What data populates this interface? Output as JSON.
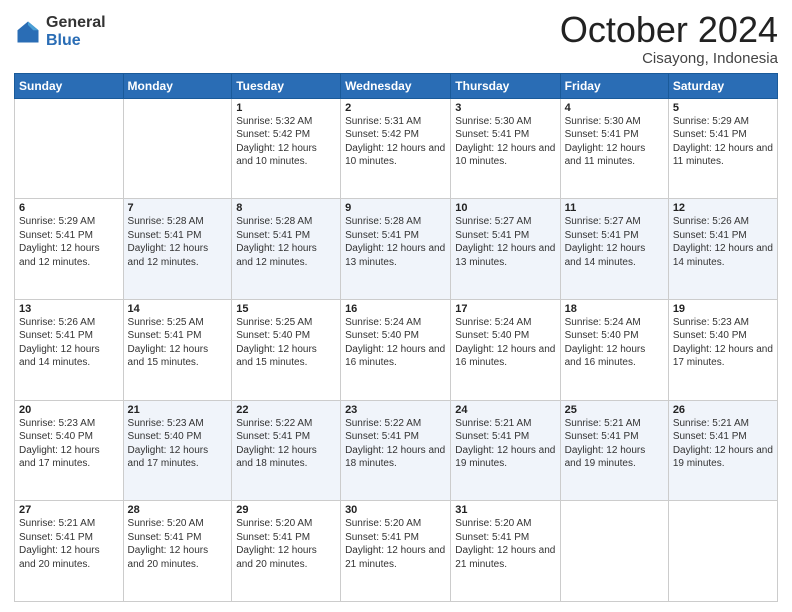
{
  "logo": {
    "general": "General",
    "blue": "Blue"
  },
  "header": {
    "month": "October 2024",
    "location": "Cisayong, Indonesia"
  },
  "weekdays": [
    "Sunday",
    "Monday",
    "Tuesday",
    "Wednesday",
    "Thursday",
    "Friday",
    "Saturday"
  ],
  "weeks": [
    [
      {
        "day": "",
        "sunrise": "",
        "sunset": "",
        "daylight": ""
      },
      {
        "day": "",
        "sunrise": "",
        "sunset": "",
        "daylight": ""
      },
      {
        "day": "1",
        "sunrise": "Sunrise: 5:32 AM",
        "sunset": "Sunset: 5:42 PM",
        "daylight": "Daylight: 12 hours and 10 minutes."
      },
      {
        "day": "2",
        "sunrise": "Sunrise: 5:31 AM",
        "sunset": "Sunset: 5:42 PM",
        "daylight": "Daylight: 12 hours and 10 minutes."
      },
      {
        "day": "3",
        "sunrise": "Sunrise: 5:30 AM",
        "sunset": "Sunset: 5:41 PM",
        "daylight": "Daylight: 12 hours and 10 minutes."
      },
      {
        "day": "4",
        "sunrise": "Sunrise: 5:30 AM",
        "sunset": "Sunset: 5:41 PM",
        "daylight": "Daylight: 12 hours and 11 minutes."
      },
      {
        "day": "5",
        "sunrise": "Sunrise: 5:29 AM",
        "sunset": "Sunset: 5:41 PM",
        "daylight": "Daylight: 12 hours and 11 minutes."
      }
    ],
    [
      {
        "day": "6",
        "sunrise": "Sunrise: 5:29 AM",
        "sunset": "Sunset: 5:41 PM",
        "daylight": "Daylight: 12 hours and 12 minutes."
      },
      {
        "day": "7",
        "sunrise": "Sunrise: 5:28 AM",
        "sunset": "Sunset: 5:41 PM",
        "daylight": "Daylight: 12 hours and 12 minutes."
      },
      {
        "day": "8",
        "sunrise": "Sunrise: 5:28 AM",
        "sunset": "Sunset: 5:41 PM",
        "daylight": "Daylight: 12 hours and 12 minutes."
      },
      {
        "day": "9",
        "sunrise": "Sunrise: 5:28 AM",
        "sunset": "Sunset: 5:41 PM",
        "daylight": "Daylight: 12 hours and 13 minutes."
      },
      {
        "day": "10",
        "sunrise": "Sunrise: 5:27 AM",
        "sunset": "Sunset: 5:41 PM",
        "daylight": "Daylight: 12 hours and 13 minutes."
      },
      {
        "day": "11",
        "sunrise": "Sunrise: 5:27 AM",
        "sunset": "Sunset: 5:41 PM",
        "daylight": "Daylight: 12 hours and 14 minutes."
      },
      {
        "day": "12",
        "sunrise": "Sunrise: 5:26 AM",
        "sunset": "Sunset: 5:41 PM",
        "daylight": "Daylight: 12 hours and 14 minutes."
      }
    ],
    [
      {
        "day": "13",
        "sunrise": "Sunrise: 5:26 AM",
        "sunset": "Sunset: 5:41 PM",
        "daylight": "Daylight: 12 hours and 14 minutes."
      },
      {
        "day": "14",
        "sunrise": "Sunrise: 5:25 AM",
        "sunset": "Sunset: 5:41 PM",
        "daylight": "Daylight: 12 hours and 15 minutes."
      },
      {
        "day": "15",
        "sunrise": "Sunrise: 5:25 AM",
        "sunset": "Sunset: 5:40 PM",
        "daylight": "Daylight: 12 hours and 15 minutes."
      },
      {
        "day": "16",
        "sunrise": "Sunrise: 5:24 AM",
        "sunset": "Sunset: 5:40 PM",
        "daylight": "Daylight: 12 hours and 16 minutes."
      },
      {
        "day": "17",
        "sunrise": "Sunrise: 5:24 AM",
        "sunset": "Sunset: 5:40 PM",
        "daylight": "Daylight: 12 hours and 16 minutes."
      },
      {
        "day": "18",
        "sunrise": "Sunrise: 5:24 AM",
        "sunset": "Sunset: 5:40 PM",
        "daylight": "Daylight: 12 hours and 16 minutes."
      },
      {
        "day": "19",
        "sunrise": "Sunrise: 5:23 AM",
        "sunset": "Sunset: 5:40 PM",
        "daylight": "Daylight: 12 hours and 17 minutes."
      }
    ],
    [
      {
        "day": "20",
        "sunrise": "Sunrise: 5:23 AM",
        "sunset": "Sunset: 5:40 PM",
        "daylight": "Daylight: 12 hours and 17 minutes."
      },
      {
        "day": "21",
        "sunrise": "Sunrise: 5:23 AM",
        "sunset": "Sunset: 5:40 PM",
        "daylight": "Daylight: 12 hours and 17 minutes."
      },
      {
        "day": "22",
        "sunrise": "Sunrise: 5:22 AM",
        "sunset": "Sunset: 5:41 PM",
        "daylight": "Daylight: 12 hours and 18 minutes."
      },
      {
        "day": "23",
        "sunrise": "Sunrise: 5:22 AM",
        "sunset": "Sunset: 5:41 PM",
        "daylight": "Daylight: 12 hours and 18 minutes."
      },
      {
        "day": "24",
        "sunrise": "Sunrise: 5:21 AM",
        "sunset": "Sunset: 5:41 PM",
        "daylight": "Daylight: 12 hours and 19 minutes."
      },
      {
        "day": "25",
        "sunrise": "Sunrise: 5:21 AM",
        "sunset": "Sunset: 5:41 PM",
        "daylight": "Daylight: 12 hours and 19 minutes."
      },
      {
        "day": "26",
        "sunrise": "Sunrise: 5:21 AM",
        "sunset": "Sunset: 5:41 PM",
        "daylight": "Daylight: 12 hours and 19 minutes."
      }
    ],
    [
      {
        "day": "27",
        "sunrise": "Sunrise: 5:21 AM",
        "sunset": "Sunset: 5:41 PM",
        "daylight": "Daylight: 12 hours and 20 minutes."
      },
      {
        "day": "28",
        "sunrise": "Sunrise: 5:20 AM",
        "sunset": "Sunset: 5:41 PM",
        "daylight": "Daylight: 12 hours and 20 minutes."
      },
      {
        "day": "29",
        "sunrise": "Sunrise: 5:20 AM",
        "sunset": "Sunset: 5:41 PM",
        "daylight": "Daylight: 12 hours and 20 minutes."
      },
      {
        "day": "30",
        "sunrise": "Sunrise: 5:20 AM",
        "sunset": "Sunset: 5:41 PM",
        "daylight": "Daylight: 12 hours and 21 minutes."
      },
      {
        "day": "31",
        "sunrise": "Sunrise: 5:20 AM",
        "sunset": "Sunset: 5:41 PM",
        "daylight": "Daylight: 12 hours and 21 minutes."
      },
      {
        "day": "",
        "sunrise": "",
        "sunset": "",
        "daylight": ""
      },
      {
        "day": "",
        "sunrise": "",
        "sunset": "",
        "daylight": ""
      }
    ]
  ]
}
